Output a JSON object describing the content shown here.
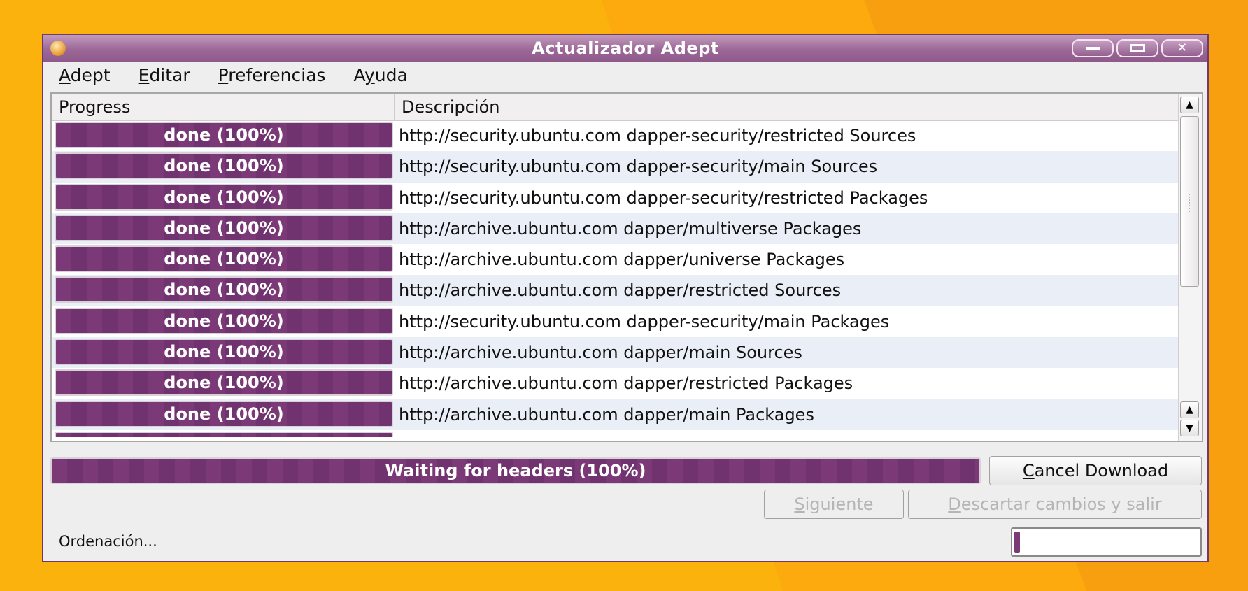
{
  "colors": {
    "desktop": "#fcb20c",
    "accent": "#7b3a77",
    "titlebar": "#9b6897"
  },
  "window": {
    "title": "Actualizador Adept",
    "icon": "adept-app-icon",
    "controls": [
      "minimize-icon",
      "maximize-icon",
      "close-icon"
    ]
  },
  "menu": [
    {
      "label": "Adept",
      "mnemonic": "A"
    },
    {
      "label": "Editar",
      "mnemonic": "E"
    },
    {
      "label": "Preferencias",
      "mnemonic": "P"
    },
    {
      "label": "Ayuda",
      "mnemonic": "y"
    }
  ],
  "list": {
    "headers": {
      "progress": "Progress",
      "description": "Descripción"
    },
    "rows": [
      {
        "progress": "done (100%)",
        "description": "http://security.ubuntu.com dapper-security/restricted Sources"
      },
      {
        "progress": "done (100%)",
        "description": "http://security.ubuntu.com dapper-security/main Sources"
      },
      {
        "progress": "done (100%)",
        "description": "http://security.ubuntu.com dapper-security/restricted Packages"
      },
      {
        "progress": "done (100%)",
        "description": "http://archive.ubuntu.com dapper/multiverse Packages"
      },
      {
        "progress": "done (100%)",
        "description": "http://archive.ubuntu.com dapper/universe Packages"
      },
      {
        "progress": "done (100%)",
        "description": "http://archive.ubuntu.com dapper/restricted Sources"
      },
      {
        "progress": "done (100%)",
        "description": "http://security.ubuntu.com dapper-security/main Packages"
      },
      {
        "progress": "done (100%)",
        "description": "http://archive.ubuntu.com dapper/main Sources"
      },
      {
        "progress": "done (100%)",
        "description": "http://archive.ubuntu.com dapper/restricted Packages"
      },
      {
        "progress": "done (100%)",
        "description": "http://archive.ubuntu.com dapper/main Packages"
      }
    ]
  },
  "overall_progress": {
    "label": "Waiting for headers (100%)",
    "fraction": 1.0
  },
  "buttons": {
    "cancel": {
      "label": "Cancel Download",
      "mnemonic": "C"
    },
    "next": {
      "label": "Siguiente",
      "mnemonic": "S",
      "enabled": false
    },
    "discard": {
      "label": "Descartar cambios y salir",
      "mnemonic": "D",
      "enabled": false
    }
  },
  "status": {
    "text": "Ordenación...",
    "mini_progress_fraction": 0.02
  }
}
